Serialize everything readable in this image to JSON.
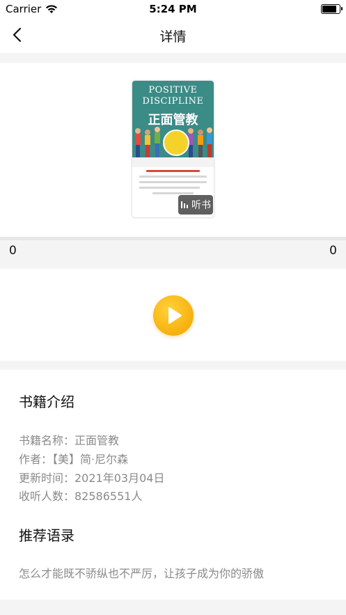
{
  "status_bar": {
    "carrier": "Carrier",
    "time": "5:24 PM",
    "battery_level": 0.9
  },
  "nav": {
    "title": "详情"
  },
  "cover": {
    "title_line1": "POSITIVE",
    "title_line2": "DISCIPLINE",
    "title_cn": "正面管教",
    "listen_label": "听书"
  },
  "player": {
    "current_time": "0",
    "total_time": "0",
    "progress": 0
  },
  "intro": {
    "heading": "书籍介绍",
    "name_line": "书籍名称：正面管教",
    "author_line": "作者：【美】简·尼尔森",
    "updated_line": "更新时间：2021年03月04日",
    "listeners_line": "收听人数：82586551人"
  },
  "quotes": {
    "heading": "推荐语录",
    "text": "怎么才能既不骄纵也不严厉，让孩子成为你的骄傲"
  },
  "colors": {
    "accent": "#f8b514",
    "cover_teal": "#3b8b86"
  }
}
